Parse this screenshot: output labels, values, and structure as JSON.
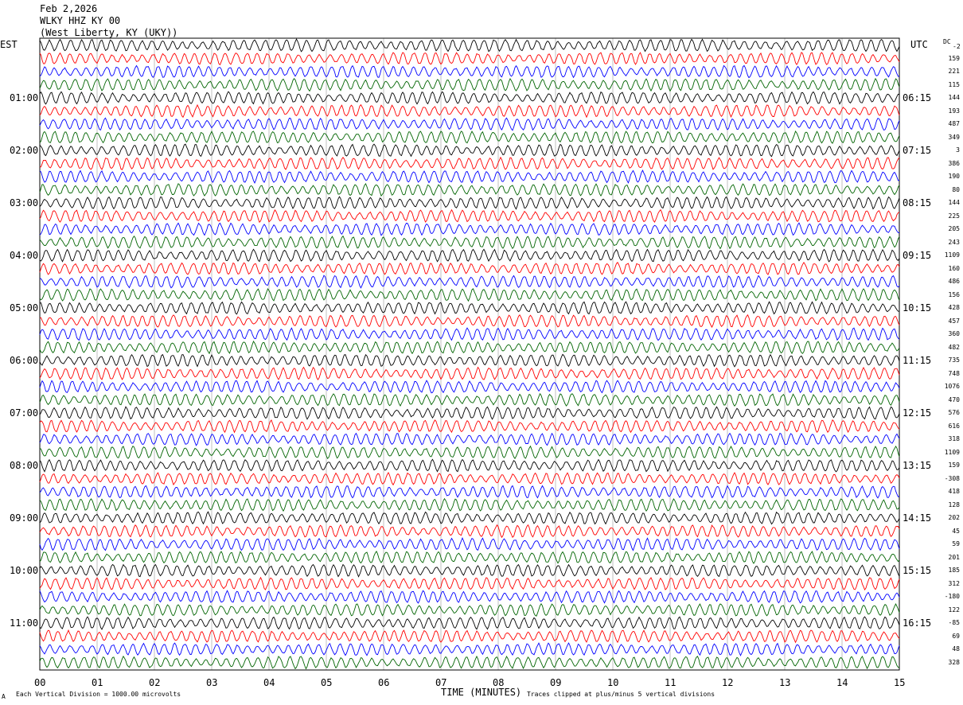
{
  "header": {
    "date": "Feb 2,2026",
    "station": "WLKY HHZ KY 00",
    "location": "(West Liberty, KY (UKY))"
  },
  "left_timezone": "EST",
  "right_timezone": "UTC",
  "dc_label": "DC",
  "dc_sub": "-2",
  "footer": {
    "left_note": "Each Vertical Division = 1000.00 microvolts",
    "right_note": "Traces clipped at plus/minus 5 vertical divisions",
    "corner_mark": "A"
  },
  "chart_data": {
    "type": "line",
    "title": "",
    "xlabel": "TIME (MINUTES)",
    "x_ticks": [
      "00",
      "01",
      "02",
      "03",
      "04",
      "05",
      "06",
      "07",
      "08",
      "09",
      "10",
      "11",
      "12",
      "13",
      "14",
      "15"
    ],
    "xlim": [
      0,
      15
    ],
    "trace_colors": [
      "#000000",
      "#ff0000",
      "#0000ff",
      "#006400"
    ],
    "left_hour_labels": [
      "01:00",
      "02:00",
      "03:00",
      "04:00",
      "05:00",
      "06:00",
      "07:00",
      "08:00",
      "09:00",
      "10:00",
      "11:00"
    ],
    "right_hour_labels": [
      "06:15",
      "07:15",
      "08:15",
      "09:15",
      "10:15",
      "11:15",
      "12:15",
      "13:15",
      "14:15",
      "15:15",
      "16:15"
    ],
    "trace_count": 48,
    "dc_offsets": [
      "159",
      "221",
      "115",
      "144",
      "193",
      "487",
      "349",
      "3",
      "386",
      "190",
      "80",
      "144",
      "225",
      "205",
      "243",
      "1109",
      "160",
      "486",
      "156",
      "428",
      "457",
      "360",
      "482",
      "735",
      "748",
      "1076",
      "470",
      "576",
      "616",
      "318",
      "1109",
      "159",
      "-308",
      "418",
      "128",
      "202",
      "45",
      "59",
      "201",
      "185",
      "312",
      "-180",
      "122",
      "-85",
      "69",
      "48",
      "328"
    ]
  }
}
